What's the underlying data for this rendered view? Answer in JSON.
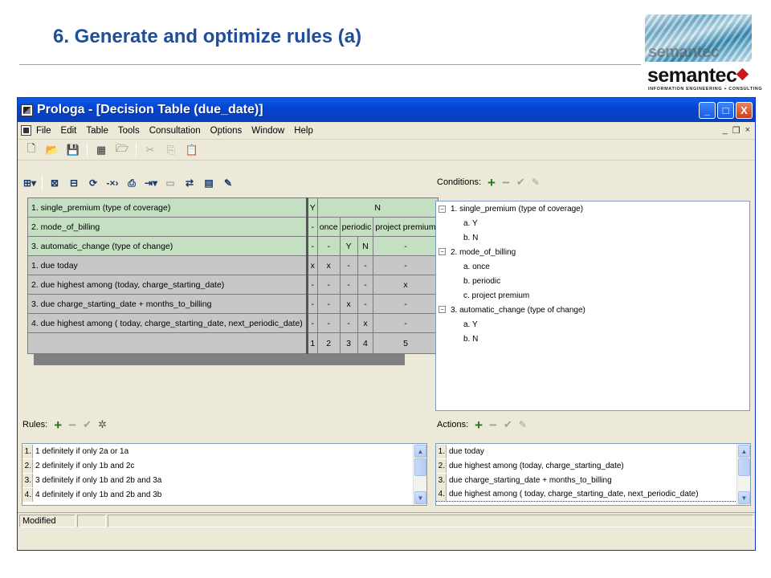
{
  "slide": {
    "title": "6. Generate and optimize rules (a)",
    "logo_ghost": "semantec",
    "logo_word": "semantec",
    "logo_tagline": "INFORMATION ENGINEERING + CONSULTING"
  },
  "window": {
    "title": "Prologa - [Decision Table (due_date)]",
    "buttons": {
      "minimize": "_",
      "maximize": "□",
      "close": "X"
    }
  },
  "menu": {
    "items": [
      "File",
      "Edit",
      "Table",
      "Tools",
      "Consultation",
      "Options",
      "Window",
      "Help"
    ],
    "mdi": {
      "minimize": "_",
      "restore": "❐",
      "close": "×"
    }
  },
  "table": {
    "conditions": [
      {
        "label": "1.  single_premium (type of coverage)",
        "cells": [
          "Y",
          "N"
        ]
      },
      {
        "label": "2.  mode_of_billing",
        "cells": [
          "-",
          "once",
          "periodic",
          "project premium"
        ]
      },
      {
        "label": "3.  automatic_change (type of change)",
        "cells": [
          "-",
          "-",
          "Y",
          "N",
          "-"
        ]
      }
    ],
    "actions": [
      {
        "label": "1.  due today",
        "cells": [
          "x",
          "x",
          "-",
          "-",
          "-"
        ]
      },
      {
        "label": "2.  due highest among (today, charge_starting_date)",
        "cells": [
          "-",
          "-",
          "-",
          "-",
          "x"
        ]
      },
      {
        "label": "3.  due charge_starting_date + months_to_billing",
        "cells": [
          "-",
          "-",
          "x",
          "-",
          "-"
        ]
      },
      {
        "label": "4.  due highest among ( today, charge_starting_date, next_periodic_date)",
        "cells": [
          "-",
          "-",
          "-",
          "x",
          "-"
        ]
      }
    ],
    "rule_numbers": [
      "1",
      "2",
      "3",
      "4",
      "5"
    ]
  },
  "conditions_panel": {
    "label": "Conditions:",
    "tree": [
      "1.  single_premium (type of coverage)",
      "a. Y",
      "b. N",
      "2.  mode_of_billing",
      "a. once",
      "b. periodic",
      "c. project premium",
      "3.  automatic_change (type of change)",
      "a. Y",
      "b. N"
    ]
  },
  "rules_panel": {
    "label": "Rules:",
    "items": [
      {
        "num": "1.",
        "text": "1 definitely if only 2a or 1a"
      },
      {
        "num": "2.",
        "text": "2 definitely if only 1b and 2c"
      },
      {
        "num": "3.",
        "text": "3 definitely if only 1b and 2b and 3a"
      },
      {
        "num": "4.",
        "text": "4 definitely if only 1b and 2b and 3b"
      }
    ]
  },
  "actions_panel": {
    "label": "Actions:",
    "items": [
      {
        "num": "1.",
        "text": "due today"
      },
      {
        "num": "2.",
        "text": "due highest among (today, charge_starting_date)"
      },
      {
        "num": "3.",
        "text": "due charge_starting_date + months_to_billing"
      },
      {
        "num": "4.",
        "text": "due highest among ( today, charge_starting_date, next_periodic_date)"
      }
    ]
  },
  "status": {
    "text": "Modified"
  }
}
